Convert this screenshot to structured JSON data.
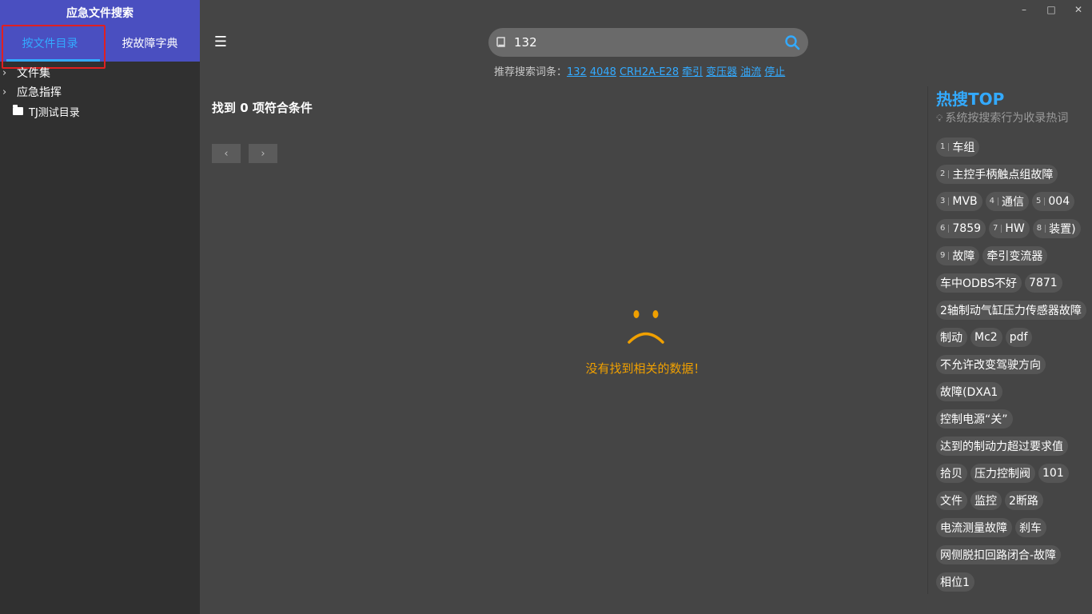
{
  "app": {
    "title": "应急文件搜索",
    "tabs": [
      {
        "label": "按文件目录",
        "active": true
      },
      {
        "label": "按故障字典",
        "active": false
      }
    ]
  },
  "sidebar": {
    "tree": [
      {
        "label": "文件集",
        "type": "collapsed"
      },
      {
        "label": "应急指挥",
        "type": "collapsed"
      },
      {
        "label": "TJ测试目录",
        "type": "folder"
      }
    ]
  },
  "window_controls": {
    "minimize": "–",
    "maximize": "□",
    "close": "✕"
  },
  "search": {
    "value": "132",
    "suggest_label": "推荐搜索词条：",
    "suggestions": [
      "132",
      "4048",
      "CRH2A-E28",
      "牵引",
      "变压器",
      "油流",
      "停止"
    ]
  },
  "results": {
    "count_text": "找到 0 项符合条件",
    "prev": "‹",
    "next": "›",
    "empty_message": "没有找到相关的数据！"
  },
  "hot": {
    "title": "热搜TOP",
    "subtitle": "系统按搜索行为收录热词",
    "rows": [
      [
        {
          "rank": "1",
          "text": "车组"
        }
      ],
      [
        {
          "rank": "2",
          "text": "主控手柄触点组故障"
        }
      ],
      [
        {
          "rank": "3",
          "text": "MVB"
        },
        {
          "rank": "4",
          "text": "通信"
        },
        {
          "rank": "5",
          "text": "004"
        }
      ],
      [
        {
          "rank": "6",
          "text": "7859"
        },
        {
          "rank": "7",
          "text": "HW"
        },
        {
          "rank": "8",
          "text": "装置)"
        }
      ],
      [
        {
          "rank": "9",
          "text": "故障"
        },
        {
          "rank": "",
          "text": "牵引变流器"
        }
      ],
      [
        {
          "rank": "",
          "text": "车中ODBS不好"
        },
        {
          "rank": "",
          "text": "7871"
        }
      ],
      [
        {
          "rank": "",
          "text": "2轴制动气缸压力传感器故障"
        }
      ],
      [
        {
          "rank": "",
          "text": "制动"
        },
        {
          "rank": "",
          "text": "Mc2"
        },
        {
          "rank": "",
          "text": "pdf"
        }
      ],
      [
        {
          "rank": "",
          "text": "不允许改变驾驶方向"
        }
      ],
      [
        {
          "rank": "",
          "text": "故障(DXA1"
        }
      ],
      [
        {
          "rank": "",
          "text": "控制电源“关”"
        }
      ],
      [
        {
          "rank": "",
          "text": "达到的制动力超过要求值"
        }
      ],
      [
        {
          "rank": "",
          "text": "拾贝"
        },
        {
          "rank": "",
          "text": "压力控制阀"
        },
        {
          "rank": "",
          "text": "101"
        }
      ],
      [
        {
          "rank": "",
          "text": "文件"
        },
        {
          "rank": "",
          "text": "监控"
        },
        {
          "rank": "",
          "text": "2断路"
        }
      ],
      [
        {
          "rank": "",
          "text": "电流测量故障"
        },
        {
          "rank": "",
          "text": "刹车"
        }
      ],
      [
        {
          "rank": "",
          "text": "网侧脱扣回路闭合-故障"
        }
      ],
      [
        {
          "rank": "",
          "text": "相位1"
        }
      ]
    ]
  },
  "colors": {
    "accent": "#33aaff",
    "header_bg": "#4a4fc0",
    "empty_warning": "#f0a000",
    "highlight": "#e02020"
  }
}
